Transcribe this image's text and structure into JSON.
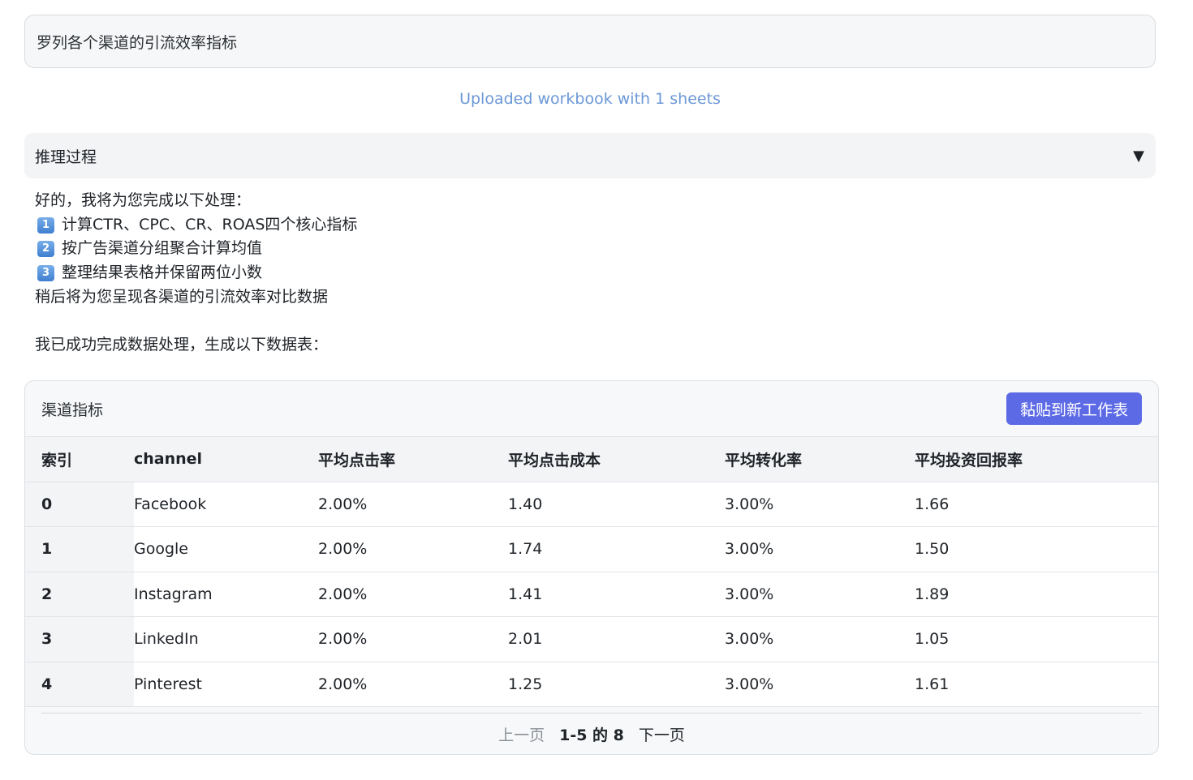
{
  "query": {
    "text": "罗列各个渠道的引流效率指标"
  },
  "upload_note": "Uploaded workbook with 1 sheets",
  "reasoning": {
    "label": "推理过程",
    "toggle_glyph": "▼"
  },
  "answer": {
    "intro": "好的，我将为您完成以下处理：",
    "steps": [
      {
        "badge": "1",
        "text": "计算CTR、CPC、CR、ROAS四个核心指标"
      },
      {
        "badge": "2",
        "text": "按广告渠道分组聚合计算均值"
      },
      {
        "badge": "3",
        "text": "整理结果表格并保留两位小数"
      }
    ],
    "outro": "稍后将为您呈现各渠道的引流效率对比数据",
    "done": "我已成功完成数据处理，生成以下数据表："
  },
  "table": {
    "title": "渠道指标",
    "paste_button": "黏贴到新工作表",
    "columns": [
      "索引",
      "channel",
      "平均点击率",
      "平均点击成本",
      "平均转化率",
      "平均投资回报率"
    ],
    "rows": [
      [
        "0",
        "Facebook",
        "2.00%",
        "1.40",
        "3.00%",
        "1.66"
      ],
      [
        "1",
        "Google",
        "2.00%",
        "1.74",
        "3.00%",
        "1.50"
      ],
      [
        "2",
        "Instagram",
        "2.00%",
        "1.41",
        "3.00%",
        "1.89"
      ],
      [
        "3",
        "LinkedIn",
        "2.00%",
        "2.01",
        "3.00%",
        "1.05"
      ],
      [
        "4",
        "Pinterest",
        "2.00%",
        "1.25",
        "3.00%",
        "1.61"
      ]
    ],
    "pager": {
      "prev": "上一页",
      "range": "1-5 的 8",
      "next": "下一页"
    }
  },
  "colors": {
    "accent_button": "#5d6ae6",
    "upload_note": "#6b98d6",
    "badge": "#4f8ad8"
  }
}
